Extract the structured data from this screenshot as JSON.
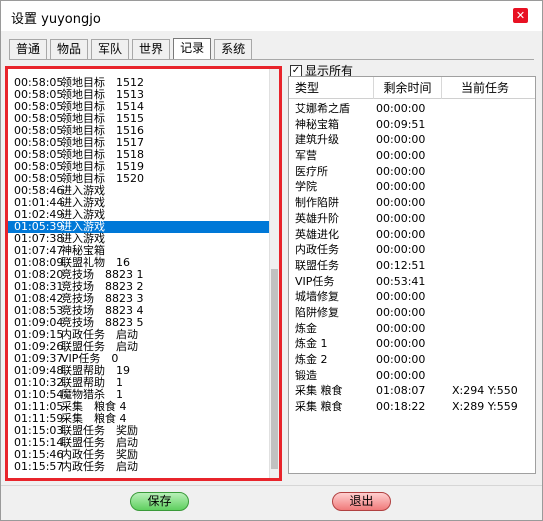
{
  "window": {
    "title": "设置 yuyongjo",
    "close_label": "✕"
  },
  "tabs": [
    {
      "label": "普通",
      "active": false
    },
    {
      "label": "物品",
      "active": false
    },
    {
      "label": "军队",
      "active": false
    },
    {
      "label": "世界",
      "active": false
    },
    {
      "label": "记录",
      "active": true
    },
    {
      "label": "系统",
      "active": false
    }
  ],
  "log": {
    "rows": [
      {
        "time": "00:58:05",
        "text": "领地目标　1512"
      },
      {
        "time": "00:58:05",
        "text": "领地目标　1513"
      },
      {
        "time": "00:58:05",
        "text": "领地目标　1514"
      },
      {
        "time": "00:58:05",
        "text": "领地目标　1515"
      },
      {
        "time": "00:58:05",
        "text": "领地目标　1516"
      },
      {
        "time": "00:58:05",
        "text": "领地目标　1517"
      },
      {
        "time": "00:58:05",
        "text": "领地目标　1518"
      },
      {
        "time": "00:58:05",
        "text": "领地目标　1519"
      },
      {
        "time": "00:58:05",
        "text": "领地目标　1520"
      },
      {
        "time": "00:58:46",
        "text": "进入游戏"
      },
      {
        "time": "01:01:44",
        "text": "进入游戏"
      },
      {
        "time": "01:02:49",
        "text": "进入游戏"
      },
      {
        "time": "01:05:39",
        "text": "进入游戏",
        "selected": true
      },
      {
        "time": "01:07:38",
        "text": "进入游戏"
      },
      {
        "time": "01:07:47",
        "text": "神秘宝箱"
      },
      {
        "time": "01:08:09",
        "text": "联盟礼物　16"
      },
      {
        "time": "01:08:20",
        "text": "竞技场　8823 1"
      },
      {
        "time": "01:08:31",
        "text": "竞技场　8823 2"
      },
      {
        "time": "01:08:42",
        "text": "竞技场　8823 3"
      },
      {
        "time": "01:08:53",
        "text": "竞技场　8823 4"
      },
      {
        "time": "01:09:04",
        "text": "竞技场　8823 5"
      },
      {
        "time": "01:09:15",
        "text": "内政任务　启动"
      },
      {
        "time": "01:09:26",
        "text": "联盟任务　启动"
      },
      {
        "time": "01:09:37",
        "text": "VIP任务　0"
      },
      {
        "time": "01:09:48",
        "text": "联盟帮助　19"
      },
      {
        "time": "01:10:32",
        "text": "联盟帮助　1"
      },
      {
        "time": "01:10:54",
        "text": "魔物猎杀　1"
      },
      {
        "time": "01:11:05",
        "text": "采集　粮食 4"
      },
      {
        "time": "01:11:59",
        "text": "采集　粮食 4"
      },
      {
        "time": "01:15:03",
        "text": "联盟任务　奖励"
      },
      {
        "time": "01:15:14",
        "text": "联盟任务　启动"
      },
      {
        "time": "01:15:46",
        "text": "内政任务　奖励"
      },
      {
        "time": "01:15:57",
        "text": "内政任务　启动"
      }
    ]
  },
  "show_all": {
    "label": "显示所有",
    "checked": "✓"
  },
  "tasks": {
    "headers": {
      "type": "类型",
      "remaining": "剩余时间",
      "current": "当前任务"
    },
    "rows": [
      {
        "type": "艾娜希之盾",
        "time": "00:00:00",
        "current": ""
      },
      {
        "type": "神秘宝箱",
        "time": "00:09:51",
        "current": ""
      },
      {
        "type": "建筑升级",
        "time": "00:00:00",
        "current": ""
      },
      {
        "type": "军营",
        "time": "00:00:00",
        "current": ""
      },
      {
        "type": "医疗所",
        "time": "00:00:00",
        "current": ""
      },
      {
        "type": "学院",
        "time": "00:00:00",
        "current": ""
      },
      {
        "type": "制作陷阱",
        "time": "00:00:00",
        "current": ""
      },
      {
        "type": "英雄升阶",
        "time": "00:00:00",
        "current": ""
      },
      {
        "type": "英雄进化",
        "time": "00:00:00",
        "current": ""
      },
      {
        "type": "内政任务",
        "time": "00:00:00",
        "current": ""
      },
      {
        "type": "联盟任务",
        "time": "00:12:51",
        "current": ""
      },
      {
        "type": "VIP任务",
        "time": "00:53:41",
        "current": ""
      },
      {
        "type": "城墙修复",
        "time": "00:00:00",
        "current": ""
      },
      {
        "type": "陷阱修复",
        "time": "00:00:00",
        "current": ""
      },
      {
        "type": "炼金",
        "time": "00:00:00",
        "current": ""
      },
      {
        "type": "炼金 1",
        "time": "00:00:00",
        "current": ""
      },
      {
        "type": "炼金 2",
        "time": "00:00:00",
        "current": ""
      },
      {
        "type": "锻造",
        "time": "00:00:00",
        "current": ""
      },
      {
        "type": "采集 粮食",
        "time": "01:08:07",
        "current": "X:294 Y:550"
      },
      {
        "type": "采集 粮食",
        "time": "00:18:22",
        "current": "X:289 Y:559"
      }
    ]
  },
  "buttons": {
    "save": "保存",
    "exit": "退出"
  }
}
